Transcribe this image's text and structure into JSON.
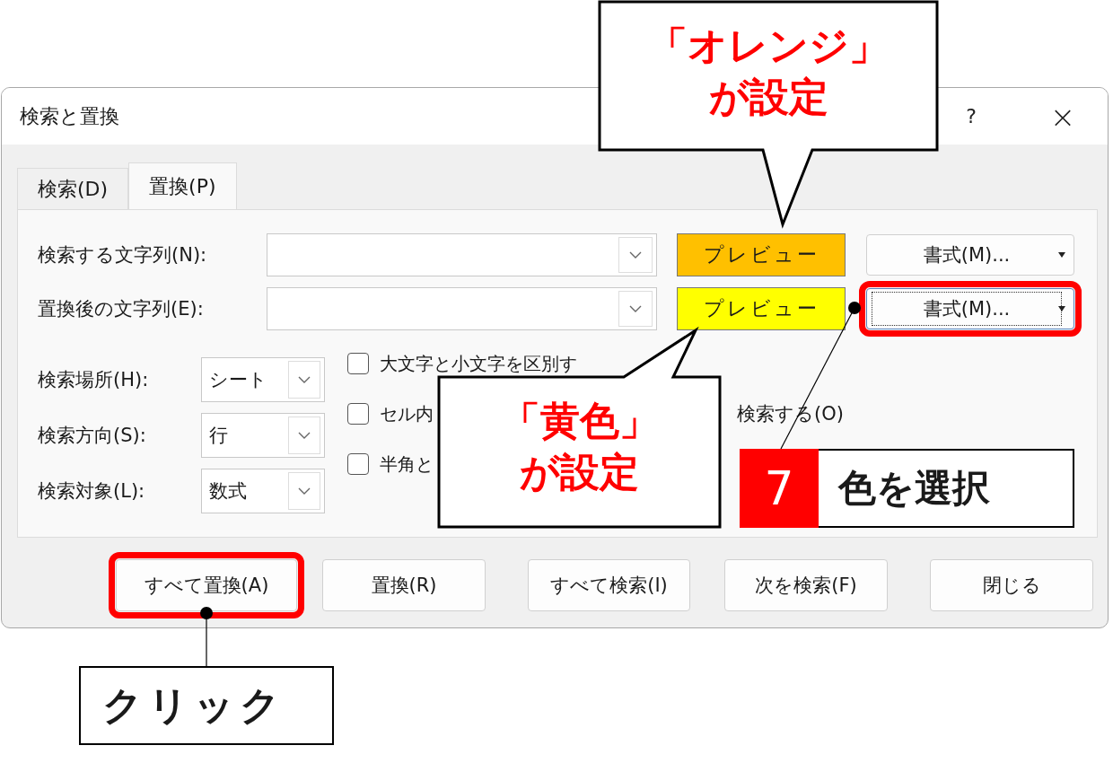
{
  "window": {
    "title": "検索と置換",
    "help": "?",
    "close": "×"
  },
  "tabs": [
    {
      "label": "検索(D)",
      "selected": false
    },
    {
      "label": "置換(P)",
      "selected": true
    }
  ],
  "find_rows": [
    {
      "label": "検索する文字列(N):",
      "preview": "プレビュー",
      "color": "#ffc000",
      "format_button": "書式(M)...",
      "focused": false,
      "highlighted": false
    },
    {
      "label": "置換後の文字列(E):",
      "preview": "プレビュー",
      "color": "#ffff00",
      "format_button": "書式(M)...",
      "focused": true,
      "highlighted": true
    }
  ],
  "options": [
    {
      "label": "検索場所(H):",
      "value": "シート"
    },
    {
      "label": "検索方向(S):",
      "value": "行"
    },
    {
      "label": "検索対象(L):",
      "value": "数式"
    }
  ],
  "checkboxes": [
    {
      "label": "大文字と小文字を区別す",
      "checked": false
    },
    {
      "label": "セル内",
      "tail": "検索する(O)",
      "checked": false
    },
    {
      "label": "半角と",
      "checked": false
    }
  ],
  "buttons": [
    {
      "label": "すべて置換(A)",
      "highlighted": true
    },
    {
      "label": "置換(R)",
      "highlighted": false
    },
    {
      "label": "すべて検索(I)",
      "highlighted": false
    },
    {
      "label": "次を検索(F)",
      "highlighted": false
    },
    {
      "label": "閉じる",
      "highlighted": false
    }
  ],
  "annotations": {
    "callouts": [
      {
        "lines": [
          "「オレンジ」",
          "が設定"
        ]
      },
      {
        "lines": [
          "「黄色」",
          "が設定"
        ]
      }
    ],
    "step": {
      "number": "7",
      "text": "色を選択"
    },
    "click_label": "クリック"
  }
}
